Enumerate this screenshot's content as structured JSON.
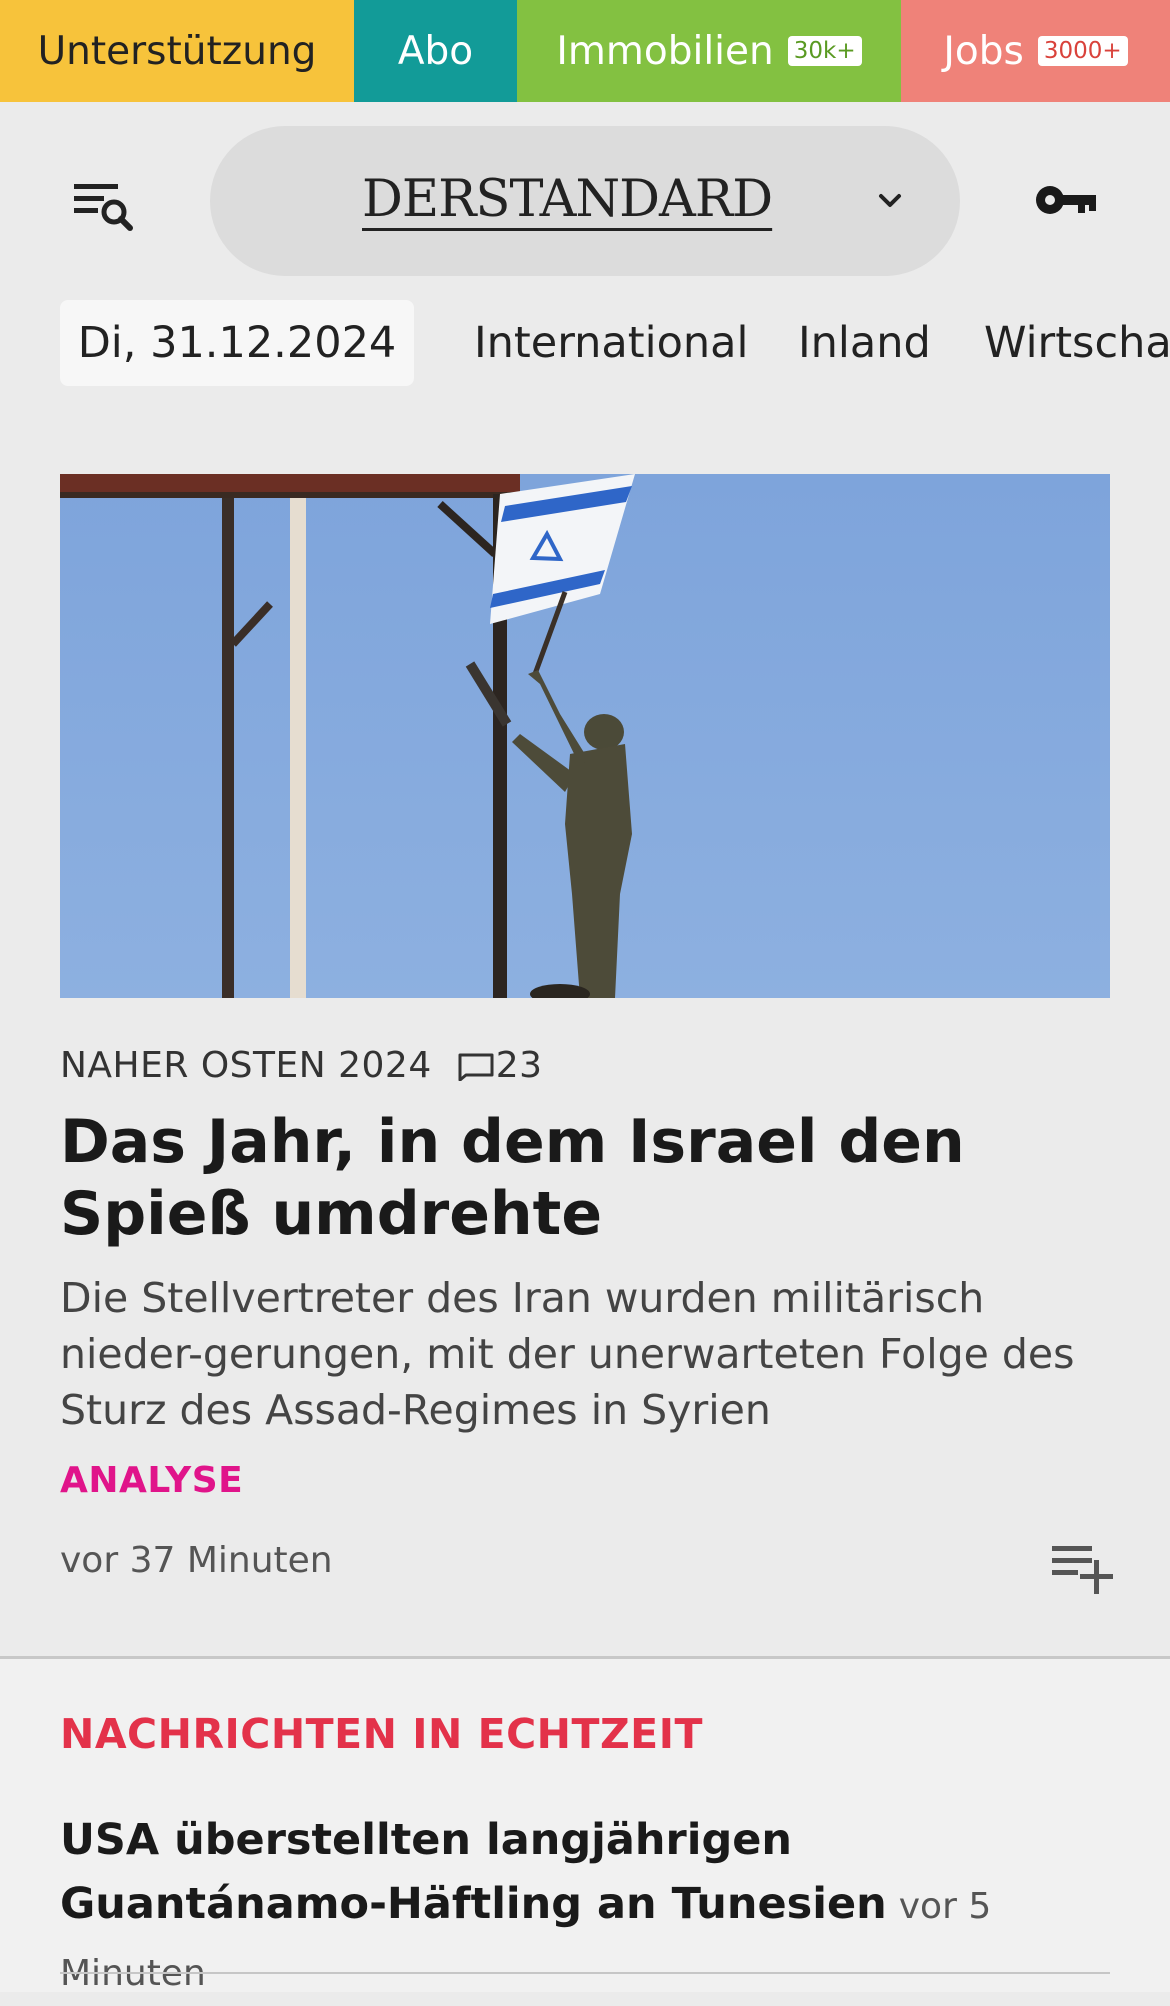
{
  "service_bar": {
    "support": "Unterstützung",
    "abo": "Abo",
    "immobilien": "Immobilien",
    "immobilien_badge": "30k+",
    "jobs": "Jobs",
    "jobs_badge": "3000+"
  },
  "header": {
    "logo": "DERSTANDARD",
    "menu_icon": "menu-search-icon",
    "dropdown_icon": "chevron-down-icon",
    "login_icon": "key-icon"
  },
  "nav": {
    "date": "Di, 31.12.2024",
    "items": [
      "International",
      "Inland",
      "Wirtscha"
    ]
  },
  "lead": {
    "kicker": "NAHER OSTEN 2024",
    "comments": "23",
    "headline": "Das Jahr, in dem Israel den Spieß umdrehte",
    "teaser": "Die Stellvertreter des Iran wurden militärisch nieder-gerungen, mit der unerwarteten Folge des Sturz des Assad-Regimes in Syrien",
    "label": "ANALYSE",
    "time": "vor 37 Minuten"
  },
  "live": {
    "title": "NACHRICHTEN IN ECHTZEIT",
    "items": [
      {
        "headline": "USA überstellten langjährigen Guantánamo-Häftling an Tunesien",
        "time": "vor 5 Minuten"
      }
    ]
  },
  "colors": {
    "support": "#f7c33b",
    "abo": "#129b98",
    "immobilien": "#83c141",
    "jobs": "#ef8279",
    "label_pink": "#e0148a",
    "live_red": "#e3324a"
  }
}
